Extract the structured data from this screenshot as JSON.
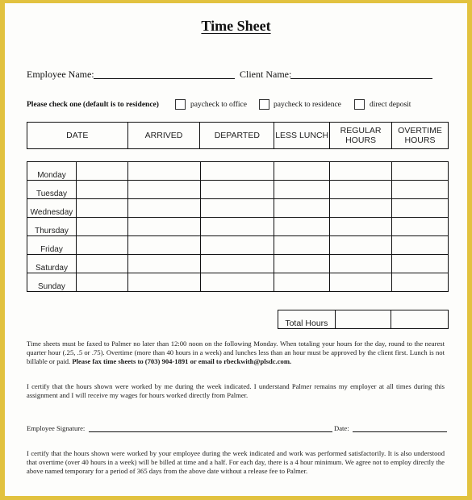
{
  "title": "Time Sheet",
  "fields": {
    "employee_name_label": "Employee Name:",
    "employee_name_value": "",
    "client_name_label": "Client Name:",
    "client_name_value": ""
  },
  "payment": {
    "prompt": "Please check one (default is to residence)",
    "options": [
      {
        "label": "paycheck to office",
        "checked": false
      },
      {
        "label": "paycheck to residence",
        "checked": false
      },
      {
        "label": "direct deposit",
        "checked": false
      }
    ]
  },
  "table": {
    "headers": [
      "DATE",
      "ARRIVED",
      "DEPARTED",
      "LESS LUNCH",
      "REGULAR HOURS",
      "OVERTIME HOURS"
    ],
    "days": [
      "Monday",
      "Tuesday",
      "Wednesday",
      "Thursday",
      "Friday",
      "Saturday",
      "Sunday"
    ],
    "total_label": "Total Hours"
  },
  "instructions": {
    "p1_text": "Time sheets must be faxed to Palmer no later than 12:00 noon on the following Monday. When totaling your hours for the day, round to the nearest quarter hour (.25, .5 or .75).  Overtime (more than 40 hours in a week) and lunches less than an hour must be approved by the client first.  Lunch is not billable or paid.  ",
    "p1_bold": "Please fax time sheets to (703) 904-1891 or email to rbeckwith@plsdc.com.",
    "p2": "I certify that the hours shown were worked by me during the week indicated.  I understand Palmer remains my employer at all times during this assignment and I will receive my wages for hours worked directly from Palmer."
  },
  "signature": {
    "employee_signature_label": "Employee Signature:",
    "date_label": "Date:"
  },
  "client_certification": "I certify that the hours shown were worked by your employee during the week indicated and work was performed satisfactorily.  It is also understood that overtime (over 40 hours in a week) will be billed at time and a half.  For each day, there is a 4 hour minimum.  We agree not to employ directly the above named temporary for a period of 365 days from the above date without a release fee to Palmer."
}
